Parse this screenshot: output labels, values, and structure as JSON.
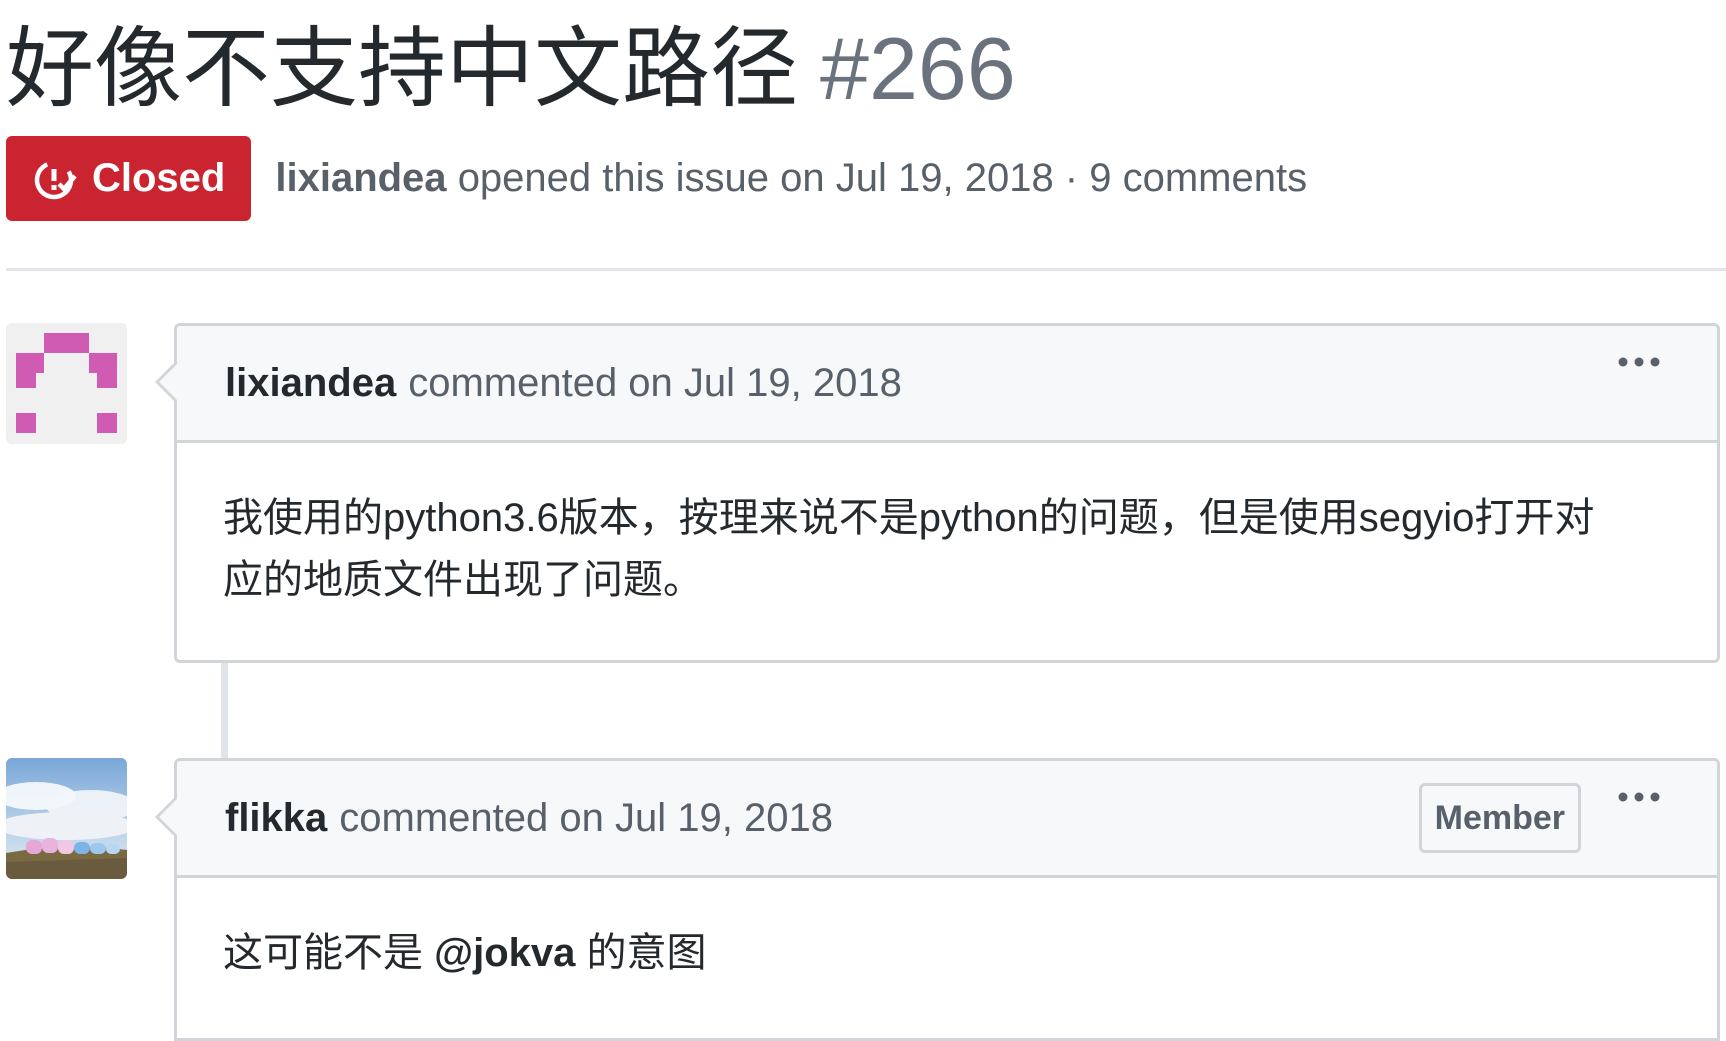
{
  "issue": {
    "title": "好像不支持中文路径",
    "number": "#266",
    "state_label": "Closed",
    "state_color": "#cb2431",
    "author": "lixiandea",
    "opened_text": "opened this issue on Jul 19, 2018 · 9 comments"
  },
  "comments": [
    {
      "author": "lixiandea",
      "action": "commented on Jul 19, 2018",
      "menu_icon": "kebab-horizontal-icon",
      "body_lines": [
        "我使用的python3.6版本，按理来说不是python的问题，但是使用segyio打开对",
        "应的地质文件出现了问题。"
      ]
    },
    {
      "author": "flikka",
      "action": "commented on Jul 19, 2018",
      "badge": "Member",
      "menu_icon": "kebab-horizontal-icon",
      "body_before": "这可能不是",
      "mention": "@jokva",
      "body_after": "的意图"
    }
  ]
}
